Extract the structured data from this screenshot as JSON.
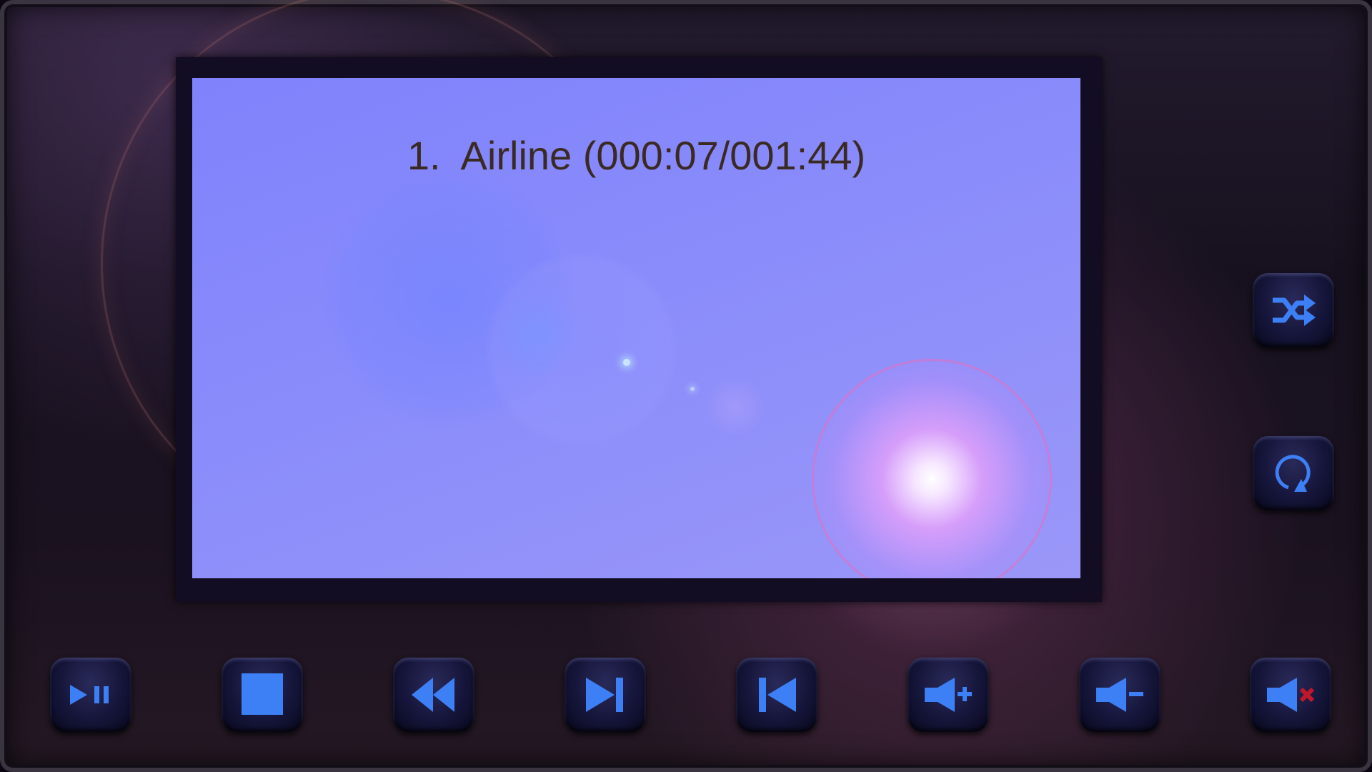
{
  "player": {
    "track_number": "1.",
    "track_title": "Airline",
    "elapsed": "000:07",
    "duration": "001:44",
    "display_text": "1.  Airline (000:07/001:44)"
  },
  "controls": {
    "bottom": [
      {
        "name": "play-pause-button",
        "icon": "play-pause-icon"
      },
      {
        "name": "stop-button",
        "icon": "stop-icon"
      },
      {
        "name": "rewind-button",
        "icon": "rewind-icon"
      },
      {
        "name": "next-track-button",
        "icon": "skip-forward-icon"
      },
      {
        "name": "previous-track-button",
        "icon": "skip-back-icon"
      },
      {
        "name": "volume-up-button",
        "icon": "volume-up-icon"
      },
      {
        "name": "volume-down-button",
        "icon": "volume-down-icon"
      },
      {
        "name": "mute-button",
        "icon": "mute-icon"
      }
    ],
    "side": [
      {
        "name": "shuffle-button",
        "icon": "shuffle-icon"
      },
      {
        "name": "repeat-button",
        "icon": "repeat-icon"
      }
    ]
  },
  "colors": {
    "screen": "#8587fb",
    "icon_blue": "#3d7ff5",
    "mute_x": "#c0182a",
    "text": "#3a2a22"
  }
}
